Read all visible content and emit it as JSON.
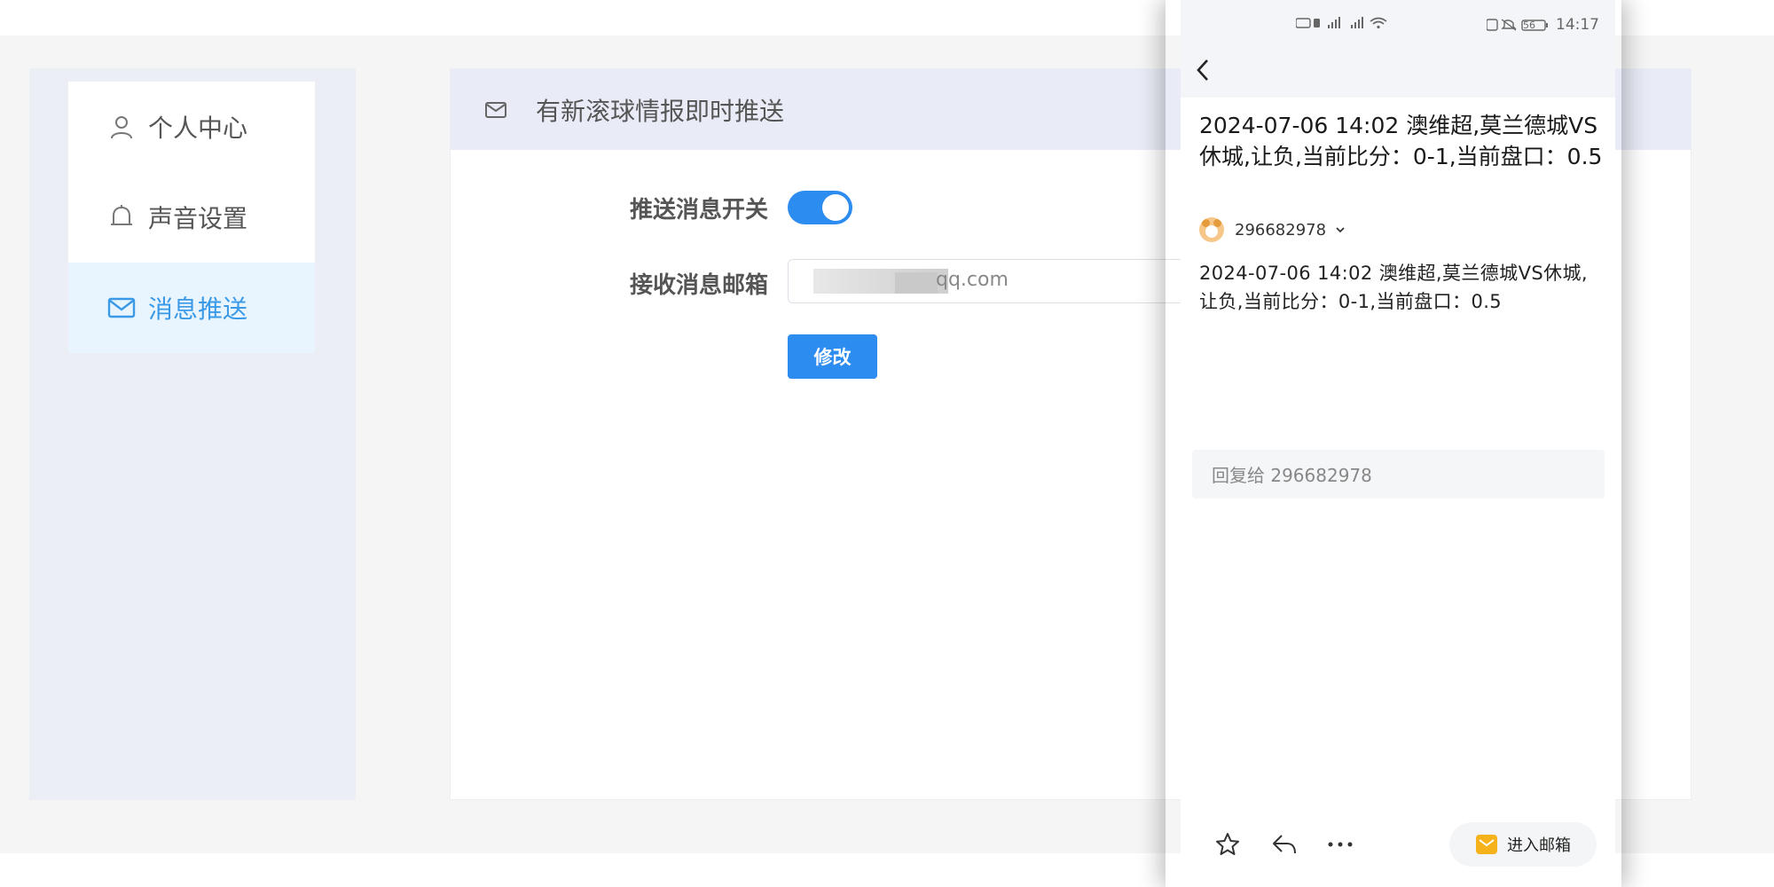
{
  "sidebar": {
    "items": [
      {
        "label": "个人中心",
        "icon": "user-icon",
        "active": false
      },
      {
        "label": "声音设置",
        "icon": "bell-icon",
        "active": false
      },
      {
        "label": "消息推送",
        "icon": "mail-icon",
        "active": true
      }
    ]
  },
  "main": {
    "header_title": "有新滚球情报即时推送",
    "push_switch_label": "推送消息开关",
    "push_switch_on": true,
    "email_label": "接收消息邮箱",
    "email_value_visible": "qq.com",
    "modify_button": "修改"
  },
  "phone": {
    "status_time": "14:17",
    "status_battery": "56",
    "subject": "2024-07-06 14:02 澳维超,莫兰德城VS休城,让负,当前比分：0-1,当前盘口：0.5",
    "sender": "296682978",
    "body": "2024-07-06 14:02 澳维超,莫兰德城VS休城,让负,当前比分：0-1,当前盘口：0.5",
    "reply_placeholder": "回复给 296682978",
    "enter_mailbox": "进入邮箱"
  },
  "colors": {
    "accent": "#2d8cf0",
    "active_text": "#3a9ae8",
    "active_bg": "#e8f4fe",
    "mail_icon": "#f5b21b"
  }
}
